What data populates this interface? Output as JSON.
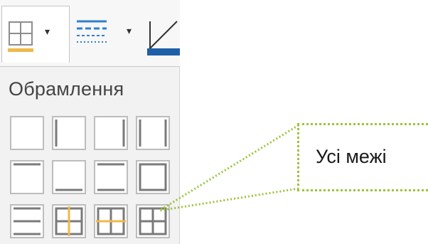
{
  "toolbar": {
    "borders_button_icon": "all-borders-icon",
    "line_style_button_icon": "line-style-icon",
    "line_color_button_icon": "line-color-icon",
    "dropdown_glyph": "▾"
  },
  "panel": {
    "title": "Обрамлення",
    "presets": [
      {
        "name": "no-borders",
        "icon": "no-borders-icon"
      },
      {
        "name": "left-border",
        "icon": "left-border-icon"
      },
      {
        "name": "right-border",
        "icon": "right-border-icon"
      },
      {
        "name": "left-right-borders",
        "icon": "left-right-borders-icon"
      },
      {
        "name": "top-border",
        "icon": "top-border-icon"
      },
      {
        "name": "bottom-border",
        "icon": "bottom-border-icon"
      },
      {
        "name": "top-bottom-borders",
        "icon": "top-bottom-borders-icon"
      },
      {
        "name": "outer-border",
        "icon": "outer-border-icon"
      },
      {
        "name": "horizontal-inner-only",
        "icon": "horizontal-inner-icon"
      },
      {
        "name": "outer-vertical-inner",
        "icon": "outer-vertical-inner-icon"
      },
      {
        "name": "outer-horizontal-inner",
        "icon": "outer-horizontal-inner-icon"
      },
      {
        "name": "all-borders",
        "icon": "all-borders-icon"
      }
    ]
  },
  "callout": {
    "label": "Усі межі"
  },
  "colors": {
    "accent_orange": "#f0b94a",
    "accent_line_green": "#9bc43b",
    "dark_blue": "#1f5fa8",
    "frame_gray": "#8a8a8a"
  }
}
